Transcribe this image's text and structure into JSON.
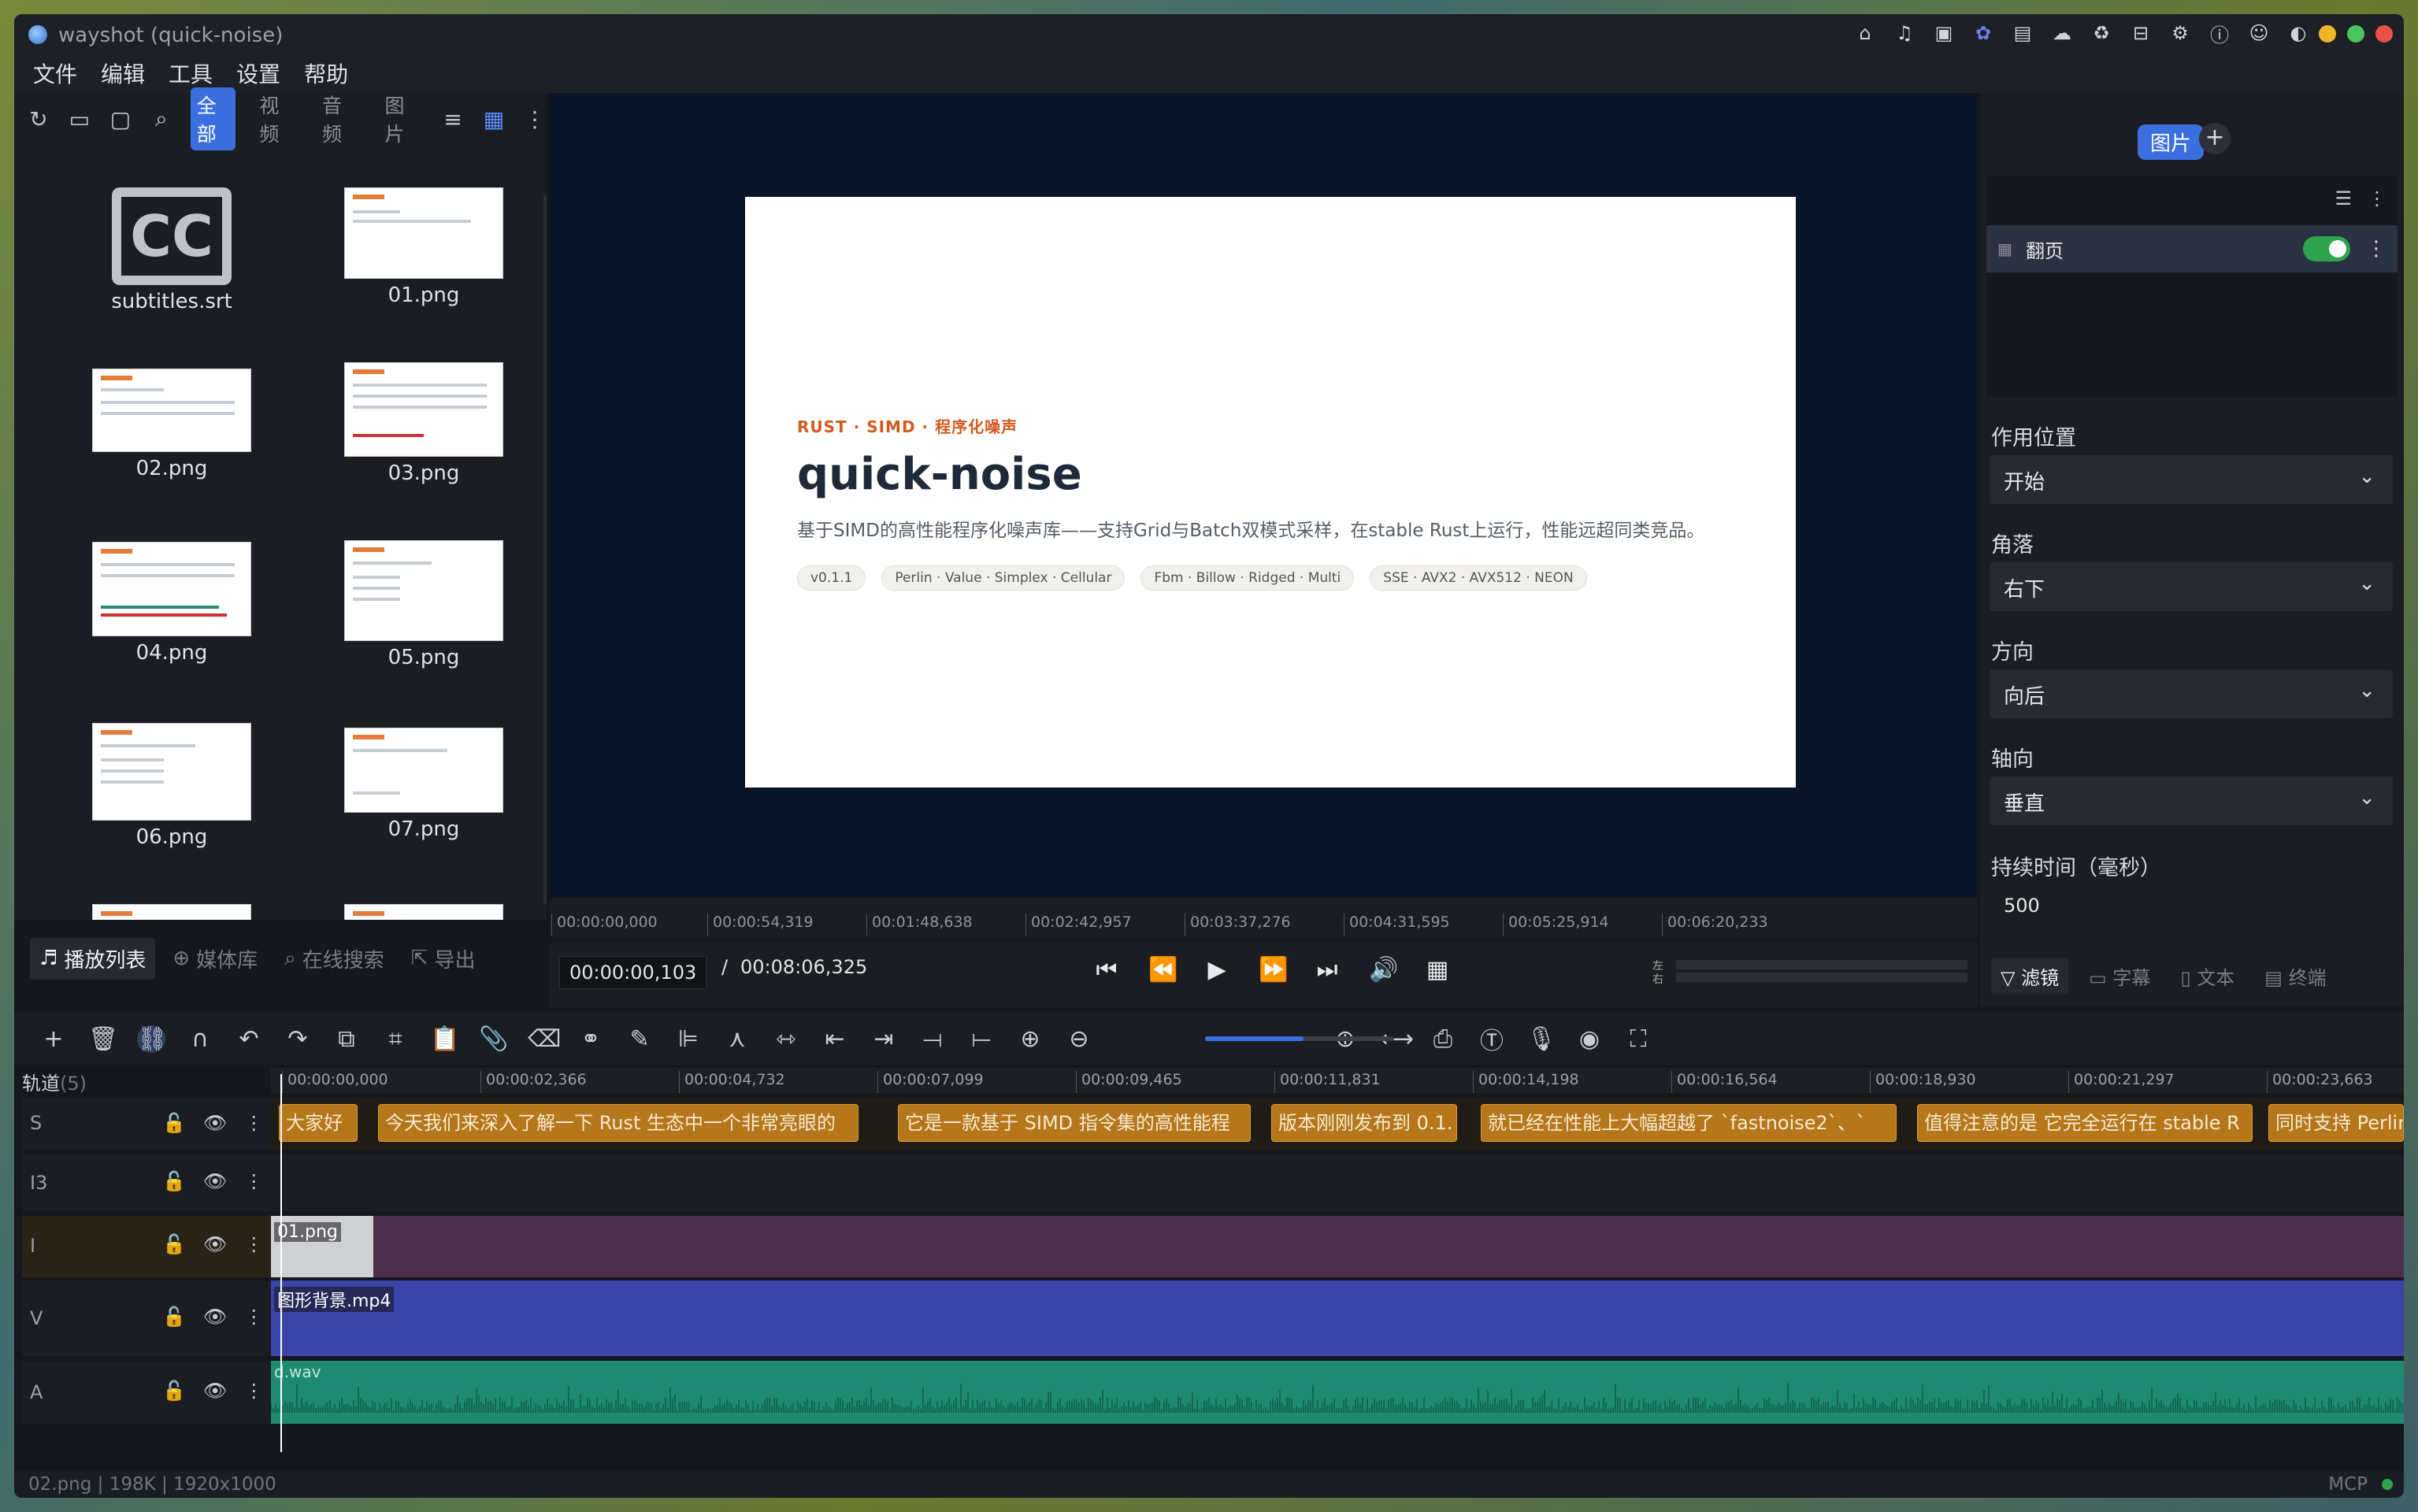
{
  "window": {
    "title": "wayshot (quick-noise)"
  },
  "menu": [
    "文件",
    "编辑",
    "工具",
    "设置",
    "帮助"
  ],
  "titlebar_icons": [
    "home-icon",
    "bell-icon",
    "window-icon",
    "palette-icon",
    "chat-icon",
    "cloud-icon",
    "recycle-icon",
    "box-icon",
    "gear-icon",
    "info-icon",
    "user-icon",
    "github-icon"
  ],
  "media": {
    "filters": [
      "全部",
      "视频",
      "音频",
      "图片"
    ],
    "active_filter": "全部",
    "items": [
      {
        "label": "subtitles.srt",
        "type": "cc"
      },
      {
        "label": "01.png"
      },
      {
        "label": "02.png"
      },
      {
        "label": "03.png"
      },
      {
        "label": "04.png"
      },
      {
        "label": "05.png"
      },
      {
        "label": "06.png"
      },
      {
        "label": "07.png"
      }
    ]
  },
  "left_tabs": [
    "播放列表",
    "媒体库",
    "在线搜索",
    "导出"
  ],
  "preview": {
    "kicker": "RUST · SIMD · 程序化噪声",
    "title": "quick-noise",
    "description": "基于SIMD的高性能程序化噪声库——支持Grid与Batch双模式采样，在stable Rust上运行，性能远超同类竞品。",
    "tags": [
      "v0.1.1",
      "Perlin · Value · Simplex · Cellular",
      "Fbm · Billow · Ridged · Multi",
      "SSE · AVX2 · AVX512 · NEON"
    ],
    "ruler_ticks": [
      "00:00:00,000",
      "00:00:54,319",
      "00:01:48,638",
      "00:02:42,957",
      "00:03:37,276",
      "00:04:31,595",
      "00:05:25,914",
      "00:06:20,233"
    ]
  },
  "transport": {
    "current": "00:00:00,103",
    "separator": "/",
    "total": "00:08:06,325",
    "vu_left": "左",
    "vu_right": "右"
  },
  "right_panel": {
    "tab": "图片",
    "filter_name": "翻页",
    "filter_enabled": true,
    "props": [
      {
        "label": "作用位置",
        "value": "开始"
      },
      {
        "label": "角落",
        "value": "右下"
      },
      {
        "label": "方向",
        "value": "向后"
      },
      {
        "label": "轴向",
        "value": "垂直"
      }
    ],
    "duration_label": "持续时间（毫秒）",
    "duration_value": "500",
    "tabs": [
      "滤镜",
      "字幕",
      "文本",
      "终端"
    ]
  },
  "timeline": {
    "header": "轨道",
    "track_count": "(5)",
    "ticks": [
      "00:00:00,000",
      "00:00:02,366",
      "00:00:04,732",
      "00:00:07,099",
      "00:00:09,465",
      "00:00:11,831",
      "00:00:14,198",
      "00:00:16,564",
      "00:00:18,930",
      "00:00:21,297",
      "00:00:23,663"
    ],
    "tracks": [
      {
        "name": "S"
      },
      {
        "name": "I3"
      },
      {
        "name": "I"
      },
      {
        "name": "V"
      },
      {
        "name": "A"
      }
    ],
    "subtitles": [
      "大家好",
      "今天我们来深入了解一下 Rust 生态中一个非常亮眼的",
      "它是一款基于 SIMD 指令集的高性能程",
      "版本刚刚发布到 0.1.",
      "就已经在性能上大幅超越了 `fastnoise2`、`",
      "值得注意的是 它完全运行在 stable R",
      "同时支持 Perlin"
    ],
    "image_clip": "01.png",
    "video_clip": "图形背景.mp4",
    "audio_clip": "d.wav"
  },
  "status": {
    "left": "02.png | 198K | 1920x1000",
    "right": "MCP"
  },
  "colors": {
    "accent": "#3b6fe0",
    "subtitle_clip": "#b5771a",
    "image_track": "#4a2f4a",
    "video_track": "#3b45a8",
    "audio_track": "#1e8a73"
  }
}
